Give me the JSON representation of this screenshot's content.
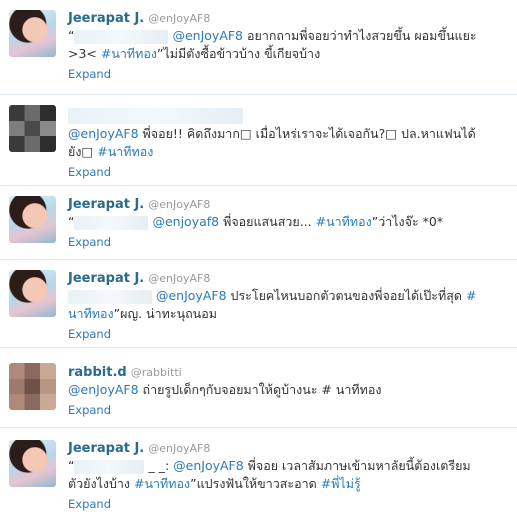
{
  "tweets": [
    {
      "name": "Jeerapat J.",
      "handle": "@enJoyAF8",
      "quote_open": "“",
      "mention": "@enJoyAF8",
      "text1": " อยากถามพี่จอยว่าทำไงสวยขึ้น ผอมขึ้นแยะ",
      "text2": ">3< ",
      "hashtag": "#นาทีทอง",
      "text3": "”ไม่มีตังซื้อข้าวบ้าง ขี้เกียจบ้าง",
      "expand": "Expand"
    },
    {
      "mention": "@enJoyAF8",
      "text1": " พี่จอย!! คิดถึงมาก□ เมื่อไหร่เราจะได้เจอกัน?□ ปล.หาแฟนได้",
      "text2": "ยัง□ ",
      "hashtag": "#นาทีทอง",
      "expand": "Expand"
    },
    {
      "name": "Jeerapat J.",
      "handle": "@enJoyAF8",
      "quote_open": "“",
      "mention": "@enjoyaf8",
      "text1": " พี่จอยแสนสวย... ",
      "hashtag": "#นาทีทอง",
      "text2": "”ว่าไงจ๊ะ *0*",
      "expand": "Expand"
    },
    {
      "name": "Jeerapat J.",
      "handle": "@enJoyAF8",
      "mention": "@enJoyAF8",
      "text1": " ประโยคไหนบอกตัวตนของพี่จอยได้เป๊ะที่สุด ",
      "hashtag_a": "#",
      "hashtag_b": "นาทีทอง",
      "text2": "”ผญ. น่าทะนุถนอม",
      "expand": "Expand"
    },
    {
      "name": "rabbit.d",
      "handle": "@rabbitti",
      "mention": "@enJoyAF8",
      "text1": " ถ่ายรูปเด็กๆกับจอยมาให้ดูบ้างนะ # นาทีทอง",
      "expand": "Expand"
    },
    {
      "name": "Jeerapat J.",
      "handle": "@enJoyAF8",
      "quote_open": "“",
      "blur_tail": "_ _:",
      "mention": "@enJoyAF8",
      "text1": " พี่จอย เวลาสัมภาษเข้ามหาลัยนี้ต้องเตรียม",
      "text2": "ตัวยังไงบ้าง ",
      "hashtag": "#นาทีทอง",
      "text3": "”แปรงฟันให้ขาวสะอาด ",
      "hashtag2": "#พี่ไม่รู้",
      "expand": "Expand"
    }
  ]
}
